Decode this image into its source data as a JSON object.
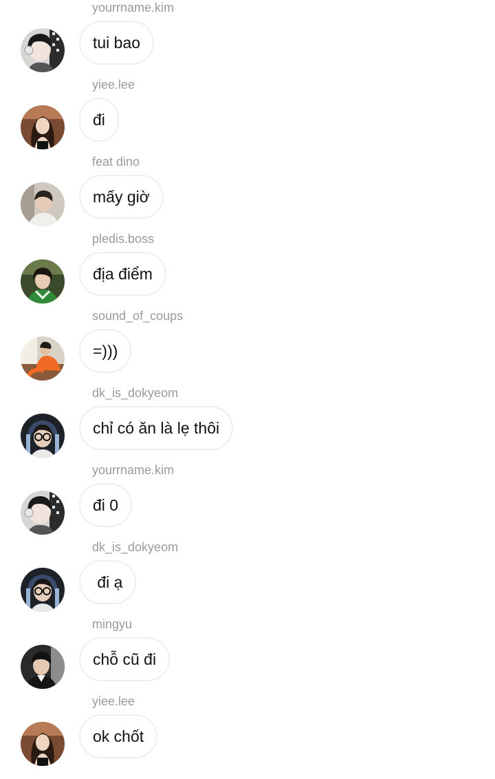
{
  "messages": [
    {
      "sender": "yourrname.kim",
      "text": "tui bao",
      "avatar": "avatar-yourrname-kim"
    },
    {
      "sender": "yiee.lee",
      "text": "đi",
      "avatar": "avatar-yiee-lee"
    },
    {
      "sender": "feat dino",
      "text": "mấy giờ",
      "avatar": "avatar-feat-dino"
    },
    {
      "sender": "pledis.boss",
      "text": "địa điểm",
      "avatar": "avatar-pledis-boss"
    },
    {
      "sender": "sound_of_coups",
      "text": "=)))",
      "avatar": "avatar-sound-of-coups"
    },
    {
      "sender": "dk_is_dokyeom",
      "text": "chỉ có ăn là lẹ thôi",
      "avatar": "avatar-dk-is-dokyeom"
    },
    {
      "sender": "yourrname.kim",
      "text": "đi 0",
      "avatar": "avatar-yourrname-kim"
    },
    {
      "sender": "dk_is_dokyeom",
      "text": " đi ạ",
      "avatar": "avatar-dk-is-dokyeom"
    },
    {
      "sender": "mingyu",
      "text": "chỗ cũ đi",
      "avatar": "avatar-mingyu"
    },
    {
      "sender": "yiee.lee",
      "text": "ok chốt",
      "avatar": "avatar-yiee-lee"
    }
  ],
  "colors": {
    "sender": "#9a9a9a",
    "bubble_border": "#efefef",
    "text": "#111111"
  }
}
